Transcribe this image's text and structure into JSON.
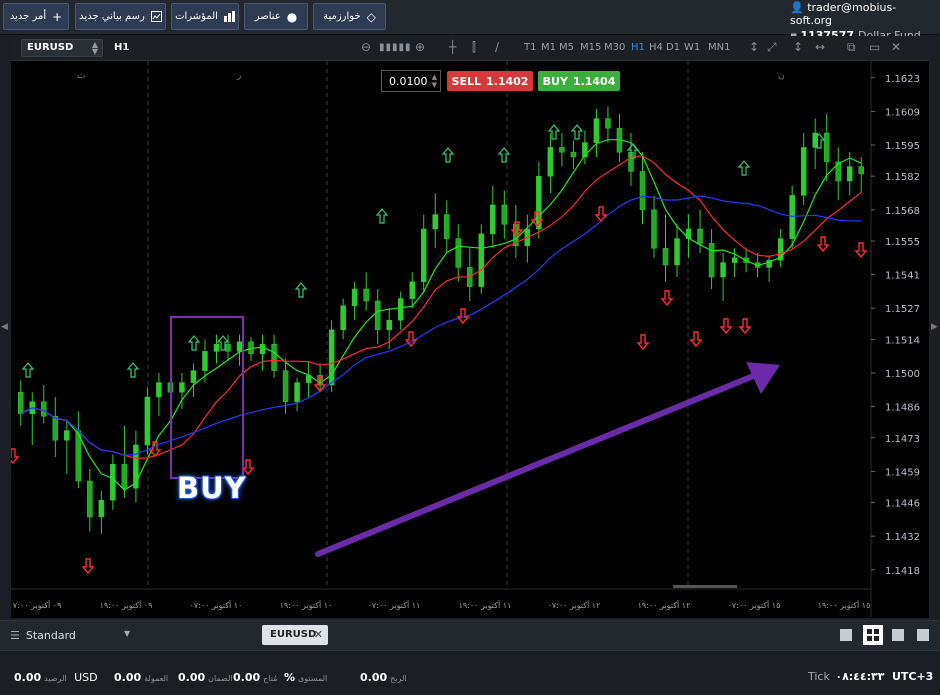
{
  "toolbar": {
    "new_order": "أمر جديد",
    "new_chart": "رسم بياني جديد",
    "indicators": "المؤشرات",
    "elements": "عناصر",
    "algorithm": "خوارزمية"
  },
  "account": {
    "email": "trader@mobius-soft.org",
    "number": "1137577",
    "name": "Dollar Fund"
  },
  "chart": {
    "symbol": "EURUSD",
    "timeframe": "H1",
    "timeframes": [
      "T1",
      "M1",
      "M5",
      "M15",
      "M30",
      "H1",
      "H4",
      "D1",
      "W1",
      "MN1"
    ],
    "active_timeframe": "H1",
    "lot": "0.0100",
    "sell_label": "SELL",
    "sell_price": "1.1402",
    "buy_label": "BUY",
    "buy_price": "1.1404",
    "annotation": "BUY"
  },
  "chart_data": {
    "type": "candlestick",
    "yticks": [
      "1.1623",
      "1.1609",
      "1.1595",
      "1.1582",
      "1.1568",
      "1.1555",
      "1.1541",
      "1.1527",
      "1.1514",
      "1.1500",
      "1.1486",
      "1.1473",
      "1.1459",
      "1.1446",
      "1.1432",
      "1.1418"
    ],
    "ylim": [
      1.141,
      1.163
    ],
    "xticks": [
      "٠٩ أكتوبر ٠٧:٠٠",
      "٠٩ أكتوبر ١٩:٠٠",
      "١٠ أكتوبر ٠٧:٠٠",
      "١٠ أكتوبر ١٩:٠٠",
      "١١ أكتوبر ٠٧:٠٠",
      "١١ أكتوبر ١٩:٠٠",
      "١٢ أكتوبر ٠٧:٠٠",
      "١٢ أكتوبر ١٩:٠٠",
      "١٥ أكتوبر ٠٧:٠٠",
      "١٥ أكتوبر ١٩:٠٠"
    ],
    "day_markers": [
      "ث",
      "ر",
      "ن"
    ],
    "candles": [
      [
        1.1492,
        1.1497,
        1.1478,
        1.1483
      ],
      [
        1.1483,
        1.1492,
        1.147,
        1.1488
      ],
      [
        1.1488,
        1.1495,
        1.1479,
        1.1482
      ],
      [
        1.1482,
        1.149,
        1.1465,
        1.1472
      ],
      [
        1.1472,
        1.148,
        1.1458,
        1.1476
      ],
      [
        1.1476,
        1.1484,
        1.1452,
        1.1455
      ],
      [
        1.1455,
        1.146,
        1.1434,
        1.144
      ],
      [
        1.144,
        1.1451,
        1.1433,
        1.1447
      ],
      [
        1.1447,
        1.1466,
        1.1443,
        1.1462
      ],
      [
        1.1462,
        1.1478,
        1.1448,
        1.1452
      ],
      [
        1.1452,
        1.1476,
        1.1446,
        1.147
      ],
      [
        1.147,
        1.1494,
        1.1466,
        1.149
      ],
      [
        1.149,
        1.15,
        1.1482,
        1.1496
      ],
      [
        1.1496,
        1.1504,
        1.1487,
        1.1492
      ],
      [
        1.1492,
        1.15,
        1.1485,
        1.1496
      ],
      [
        1.1496,
        1.1504,
        1.149,
        1.1501
      ],
      [
        1.1501,
        1.1514,
        1.1496,
        1.1509
      ],
      [
        1.1509,
        1.1516,
        1.1504,
        1.1512
      ],
      [
        1.1512,
        1.1516,
        1.1505,
        1.1509
      ],
      [
        1.1509,
        1.1516,
        1.1503,
        1.1513
      ],
      [
        1.1513,
        1.1515,
        1.1505,
        1.1508
      ],
      [
        1.1508,
        1.1516,
        1.1501,
        1.1512
      ],
      [
        1.1512,
        1.1516,
        1.1498,
        1.1501
      ],
      [
        1.1501,
        1.1506,
        1.1483,
        1.1488
      ],
      [
        1.1488,
        1.1498,
        1.1484,
        1.1496
      ],
      [
        1.1496,
        1.1505,
        1.149,
        1.1499
      ],
      [
        1.1499,
        1.1504,
        1.1492,
        1.1495
      ],
      [
        1.1495,
        1.1522,
        1.1492,
        1.1518
      ],
      [
        1.1518,
        1.1531,
        1.1514,
        1.1528
      ],
      [
        1.1528,
        1.1538,
        1.1522,
        1.1535
      ],
      [
        1.1535,
        1.1542,
        1.1526,
        1.153
      ],
      [
        1.153,
        1.1535,
        1.1512,
        1.1518
      ],
      [
        1.1518,
        1.1527,
        1.151,
        1.1522
      ],
      [
        1.1522,
        1.1534,
        1.1518,
        1.1531
      ],
      [
        1.1531,
        1.1542,
        1.1527,
        1.1538
      ],
      [
        1.1538,
        1.1566,
        1.1534,
        1.156
      ],
      [
        1.156,
        1.1575,
        1.1552,
        1.1566
      ],
      [
        1.1566,
        1.1572,
        1.155,
        1.1556
      ],
      [
        1.1556,
        1.1562,
        1.1538,
        1.1544
      ],
      [
        1.1544,
        1.1552,
        1.153,
        1.1536
      ],
      [
        1.1536,
        1.1562,
        1.1533,
        1.1558
      ],
      [
        1.1558,
        1.1578,
        1.1552,
        1.157
      ],
      [
        1.157,
        1.1576,
        1.1556,
        1.1562
      ],
      [
        1.1562,
        1.157,
        1.1548,
        1.1553
      ],
      [
        1.1553,
        1.1566,
        1.1546,
        1.156
      ],
      [
        1.156,
        1.1588,
        1.1556,
        1.1582
      ],
      [
        1.1582,
        1.16,
        1.1575,
        1.1594
      ],
      [
        1.1594,
        1.16,
        1.1586,
        1.1592
      ],
      [
        1.1592,
        1.1597,
        1.1585,
        1.159
      ],
      [
        1.159,
        1.1601,
        1.1587,
        1.1596
      ],
      [
        1.1596,
        1.161,
        1.159,
        1.1606
      ],
      [
        1.1606,
        1.1611,
        1.1596,
        1.1602
      ],
      [
        1.1602,
        1.1608,
        1.1588,
        1.1592
      ],
      [
        1.1592,
        1.16,
        1.1578,
        1.1584
      ],
      [
        1.1584,
        1.1592,
        1.1562,
        1.1568
      ],
      [
        1.1568,
        1.1574,
        1.1548,
        1.1552
      ],
      [
        1.1552,
        1.1566,
        1.1538,
        1.1545
      ],
      [
        1.1545,
        1.1562,
        1.154,
        1.1556
      ],
      [
        1.1556,
        1.1566,
        1.1548,
        1.156
      ],
      [
        1.156,
        1.1568,
        1.155,
        1.1554
      ],
      [
        1.1554,
        1.156,
        1.1535,
        1.154
      ],
      [
        1.154,
        1.155,
        1.153,
        1.1546
      ],
      [
        1.1546,
        1.1552,
        1.154,
        1.1548
      ],
      [
        1.1548,
        1.1552,
        1.1542,
        1.1546
      ],
      [
        1.1546,
        1.155,
        1.154,
        1.1544
      ],
      [
        1.1544,
        1.1549,
        1.1538,
        1.1547
      ],
      [
        1.1547,
        1.156,
        1.1544,
        1.1556
      ],
      [
        1.1556,
        1.1578,
        1.1552,
        1.1574
      ],
      [
        1.1574,
        1.16,
        1.157,
        1.1594
      ],
      [
        1.1594,
        1.1606,
        1.1585,
        1.16
      ],
      [
        1.16,
        1.1608,
        1.158,
        1.1588
      ],
      [
        1.1588,
        1.1594,
        1.1572,
        1.158
      ],
      [
        1.158,
        1.1592,
        1.1574,
        1.1586
      ],
      [
        1.1586,
        1.159,
        1.1575,
        1.1583
      ]
    ],
    "series": [
      {
        "name": "green",
        "color": "#1fe81f"
      },
      {
        "name": "red",
        "color": "#ff2a2a"
      },
      {
        "name": "blue",
        "color": "#1f3cff"
      }
    ]
  },
  "tabs": {
    "template": "Standard",
    "active_tab": "EURUSD"
  },
  "status": {
    "balance_value": "0.00",
    "balance_currency": "USD",
    "balance_label": "الرصيد",
    "commission_value": "0.00",
    "commission_label": "العمولة",
    "margin_value": "0.00",
    "margin_label": "الضمان",
    "available_value": "0.00",
    "available_label": "مُتاح",
    "level_value": "%",
    "level_label": "المستوى",
    "profit_value": "0.00",
    "profit_label": "الربح",
    "tick_label": "Tick",
    "time_value": "٠٨:٤٤:٣٣",
    "tz_value": "UTC+3"
  }
}
